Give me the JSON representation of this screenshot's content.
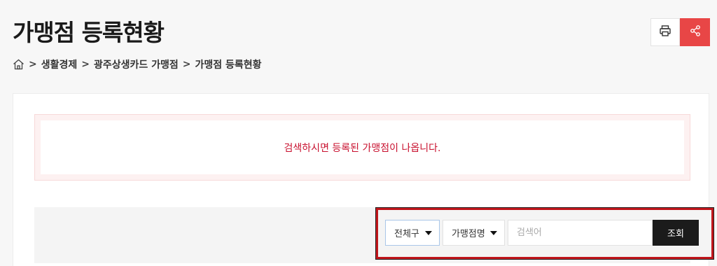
{
  "header": {
    "title": "가맹점 등록현황",
    "print_icon": "printer-icon",
    "share_icon": "share-icon",
    "share_color": "#e84646"
  },
  "breadcrumb": {
    "home_icon": "home-icon",
    "items": [
      "생활경제",
      "광주상생카드 가맹점",
      "가맹점 등록현황"
    ]
  },
  "notice": {
    "text": "검색하시면 등록된 가맹점이 나옵니다.",
    "color": "#c8102e"
  },
  "search": {
    "district_selected": "전체구",
    "field_selected": "가맹점명",
    "placeholder": "검색어",
    "value": "",
    "button_label": "조회",
    "highlight_color": "#c0161c"
  }
}
